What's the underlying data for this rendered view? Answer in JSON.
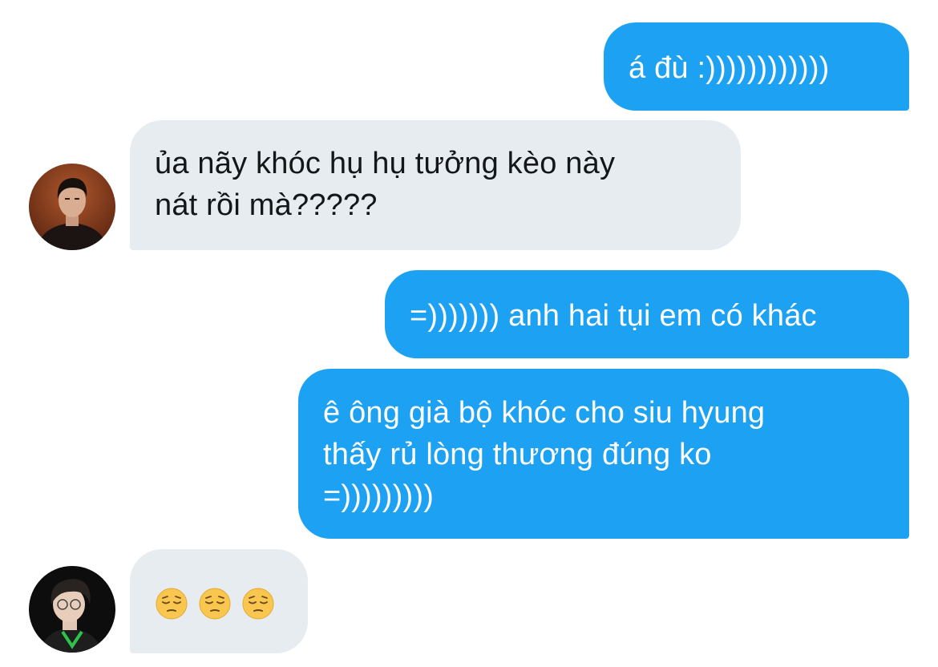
{
  "messages": [
    {
      "side": "sent",
      "text": "á đù :))))))))))))"
    },
    {
      "side": "received",
      "text": "ủa nãy khóc hụ hụ tưởng kèo này\nnát rồi mà?????"
    },
    {
      "side": "sent",
      "text": "=))))))) anh hai tụi em có khác"
    },
    {
      "side": "sent",
      "text": "ê ông già bộ khóc cho siu hyung\nthấy rủ lòng thương đúng ko\n=)))))))))"
    },
    {
      "side": "received",
      "emojis": [
        "pensive-face",
        "pensive-face",
        "pensive-face"
      ]
    }
  ],
  "colors": {
    "sent_bubble": "#1da1f2",
    "received_bubble": "#e6ecf0",
    "sent_text": "#ffffff",
    "received_text": "#14171a"
  }
}
